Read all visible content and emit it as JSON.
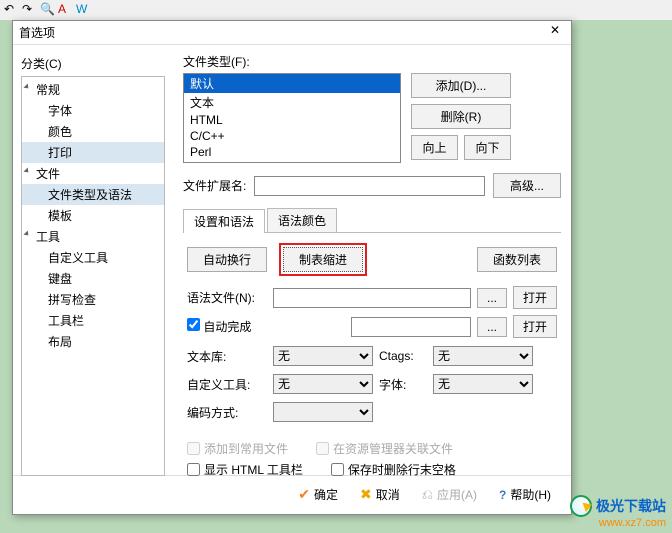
{
  "dialog_title": "首选项",
  "category_label": "分类(C)",
  "tree": {
    "general": "常规",
    "font": "字体",
    "color": "颜色",
    "print": "打印",
    "file": "文件",
    "filetype_syntax": "文件类型及语法",
    "template": "模板",
    "tools": "工具",
    "custom_tools": "自定义工具",
    "keyboard": "键盘",
    "spellcheck": "拼写检查",
    "toolbar": "工具栏",
    "layout": "布局"
  },
  "filetype_label": "文件类型(F):",
  "filetypes": [
    "默认",
    "文本",
    "HTML",
    "C/C++",
    "Perl"
  ],
  "buttons": {
    "add": "添加(D)...",
    "delete": "删除(R)",
    "up": "向上",
    "down": "向下",
    "advanced": "高级...",
    "func_list": "函数列表",
    "browse": "...",
    "open": "打开"
  },
  "ext_label": "文件扩展名:",
  "tabs": {
    "settings": "设置和语法",
    "colors": "语法颜色"
  },
  "auto_wrap": "自动换行",
  "tab_indent": "制表缩进",
  "grammar_file_label": "语法文件(N):",
  "auto_complete": "自动完成",
  "text_lib_label": "文本库:",
  "custom_tool_label": "自定义工具:",
  "encoding_label": "编码方式:",
  "ctags_label": "Ctags:",
  "font_label2": "字体:",
  "combo_none": "无",
  "checks": {
    "add_common": "添加到常用文件",
    "assoc_explorer": "在资源管理器关联文件",
    "show_html_toolbar": "显示 HTML 工具栏",
    "trim_trailing": "保存时删除行末空格"
  },
  "footer": {
    "ok": "确定",
    "cancel": "取消",
    "apply": "应用(A)",
    "help": "帮助(H)"
  },
  "watermark": {
    "name": "极光下载站",
    "url": "www.xz7.com"
  }
}
